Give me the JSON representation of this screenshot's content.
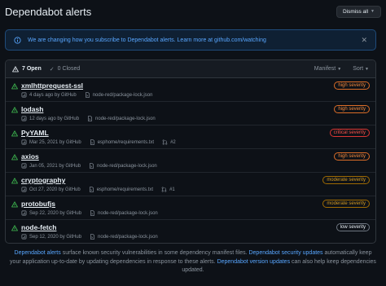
{
  "header": {
    "title": "Dependabot alerts",
    "dismiss_label": "Dismiss all"
  },
  "banner": {
    "text": "We are changing how you subscribe to Dependabot alerts. Learn more at github.com/watching"
  },
  "tabs": {
    "open": "7 Open",
    "closed": "0 Closed"
  },
  "filters": {
    "manifest": "Manifest",
    "sort": "Sort"
  },
  "alerts": [
    {
      "name": "xmlhttprequest-ssl",
      "date": "4 days ago by GitHub",
      "manifest": "node-red/package-lock.json",
      "pr": "",
      "severity": "high severity"
    },
    {
      "name": "lodash",
      "date": "12 days ago by GitHub",
      "manifest": "node-red/package-lock.json",
      "pr": "",
      "severity": "high severity"
    },
    {
      "name": "PyYAML",
      "date": "Mar 25, 2021 by GitHub",
      "manifest": "esphome/requirements.txt",
      "pr": "#2",
      "severity": "critical severity"
    },
    {
      "name": "axios",
      "date": "Jan 05, 2021 by GitHub",
      "manifest": "node-red/package-lock.json",
      "pr": "",
      "severity": "high severity"
    },
    {
      "name": "cryptography",
      "date": "Oct 27, 2020 by GitHub",
      "manifest": "esphome/requirements.txt",
      "pr": "#1",
      "severity": "moderate severity"
    },
    {
      "name": "protobufjs",
      "date": "Sep 22, 2020 by GitHub",
      "manifest": "node-red/package-lock.json",
      "pr": "",
      "severity": "moderate severity"
    },
    {
      "name": "node-fetch",
      "date": "Sep 12, 2020 by GitHub",
      "manifest": "node-red/package-lock.json",
      "pr": "",
      "severity": "low severity"
    }
  ],
  "footer": {
    "link1": "Dependabot alerts",
    "text1": " surface known security vulnerabilities in some dependency manifest files. ",
    "link2": "Dependabot security updates",
    "text2": " automatically keep your application up-to-date by updating dependencies in response to these alerts. ",
    "link3": "Dependabot version updates",
    "text3": " can also help keep dependencies updated."
  },
  "colors": {
    "background": "#0d1117",
    "link": "#58a6ff",
    "alert_icon": "#3fb950",
    "high": "#db6d28",
    "critical": "#da3633",
    "moderate": "#9e6a03"
  }
}
